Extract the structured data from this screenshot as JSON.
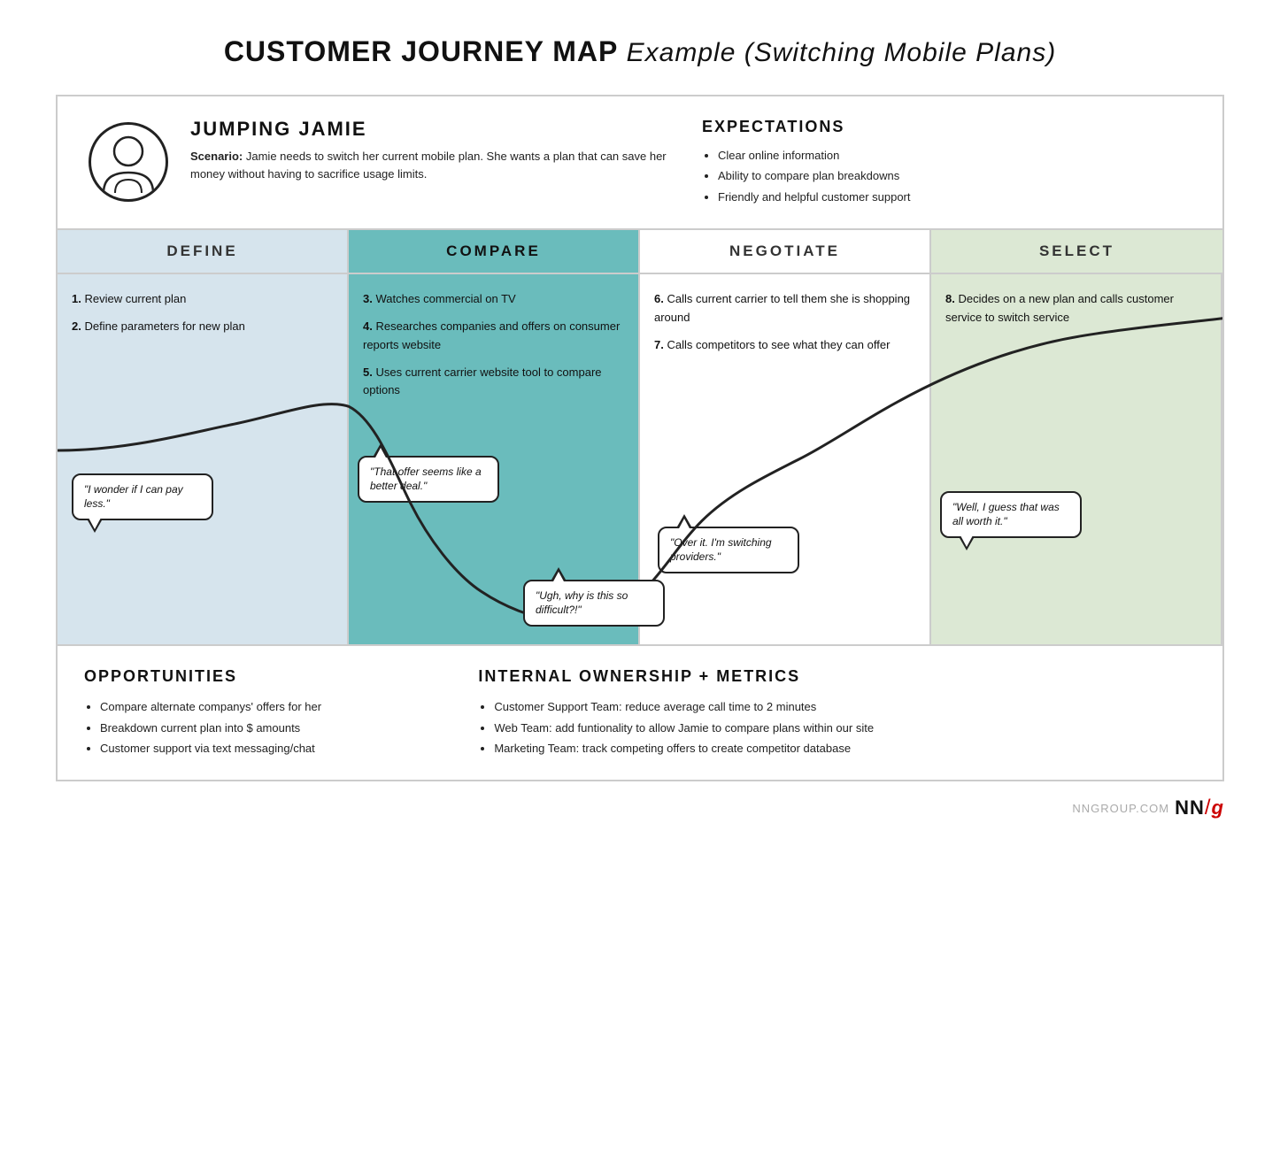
{
  "title": {
    "bold_part": "CUSTOMER JOURNEY MAP",
    "italic_part": "Example (Switching Mobile Plans)"
  },
  "persona": {
    "name": "JUMPING JAMIE",
    "scenario_label": "Scenario:",
    "scenario_text": "Jamie needs to switch her current mobile plan. She wants a plan that can save her money without having to sacrifice usage limits."
  },
  "expectations": {
    "title": "EXPECTATIONS",
    "items": [
      "Clear online information",
      "Ability to compare plan breakdowns",
      "Friendly and helpful customer support"
    ]
  },
  "phases": [
    {
      "id": "define",
      "label": "DEFINE"
    },
    {
      "id": "compare",
      "label": "COMPARE"
    },
    {
      "id": "negotiate",
      "label": "NEGOTIATE"
    },
    {
      "id": "select",
      "label": "SELECT"
    }
  ],
  "define": {
    "steps": [
      {
        "num": "1.",
        "text": "Review current plan"
      },
      {
        "num": "2.",
        "text": "Define parameters for new plan"
      }
    ],
    "bubble": "\"I wonder if I can pay less.\""
  },
  "compare": {
    "steps": [
      {
        "num": "3.",
        "text": "Watches commercial on TV"
      },
      {
        "num": "4.",
        "text": "Researches companies and offers on consumer reports website"
      },
      {
        "num": "5.",
        "text": "Uses current carrier website tool to compare options"
      }
    ],
    "bubble1": "\"That offer seems like a better deal.\"",
    "bubble2": "\"Ugh, why is this so difficult?!\""
  },
  "negotiate": {
    "steps": [
      {
        "num": "6.",
        "text": "Calls current carrier to tell them she is shopping around"
      },
      {
        "num": "7.",
        "text": "Calls competitors to see what they can offer"
      }
    ],
    "bubble": "\"Over it. I'm switching providers.\""
  },
  "select": {
    "steps": [
      {
        "num": "8.",
        "text": "Decides on a new plan and calls customer service to switch service"
      }
    ],
    "bubble": "\"Well, I guess that was all worth it.\""
  },
  "opportunities": {
    "title": "OPPORTUNITIES",
    "items": [
      "Compare alternate companys' offers for her",
      "Breakdown current plan into $ amounts",
      "Customer support via text messaging/chat"
    ]
  },
  "internal": {
    "title": "INTERNAL OWNERSHIP + METRICS",
    "items": [
      "Customer Support Team: reduce average call time to 2 minutes",
      "Web Team: add funtionality to allow Jamie to compare plans within our site",
      "Marketing Team: track competing offers to create competitor database"
    ]
  },
  "branding": {
    "site": "NNGROUP.COM",
    "logo_nn": "NN",
    "logo_slash": "/",
    "logo_g": "g"
  }
}
